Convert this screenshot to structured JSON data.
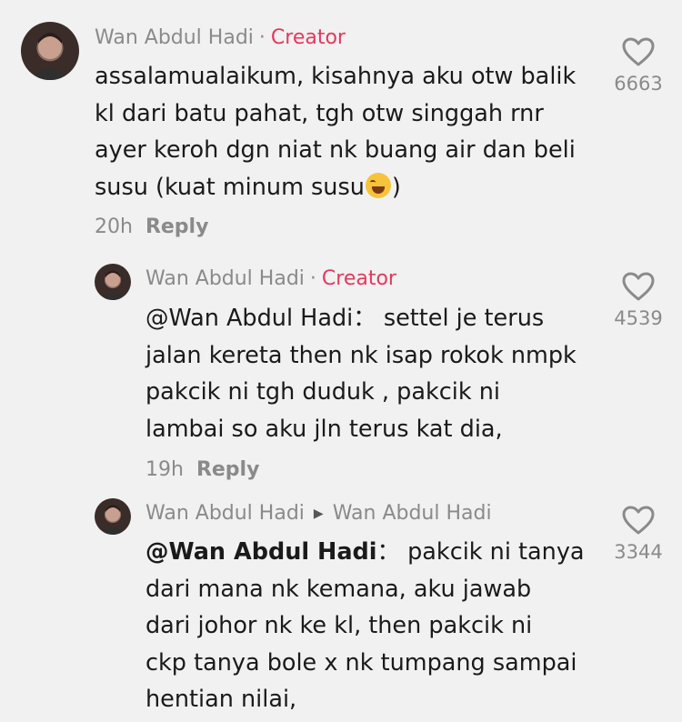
{
  "comments": [
    {
      "author": "Wan Abdul Hadi",
      "badge": "Creator",
      "reply_to": "",
      "mention": "",
      "lines": [
        "assalamualaikum, kisahnya aku otw balik",
        "kl dari batu pahat, tgh otw singgah rnr",
        "ayer keroh dgn niat nk buang air dan beli",
        "susu (kuat minum susu"
      ],
      "line4_emoji": "face-with-tears-of-joy-emoji",
      "line4_tail": ")",
      "time": "20h",
      "reply_label": "Reply",
      "likes": "6663"
    },
    {
      "author": "Wan Abdul Hadi",
      "badge": "Creator",
      "reply_to": "",
      "mention": "@Wan Abdul Hadi",
      "lines": [
        "：  settel je terus",
        "jalan kereta then nk isap rokok nmpk",
        "pakcik ni tgh duduk , pakcik ni",
        "lambai so aku jln terus kat dia,"
      ],
      "time": "19h",
      "reply_label": "Reply",
      "likes": "4539"
    },
    {
      "author": "Wan Abdul Hadi",
      "badge": "",
      "reply_to": "Wan Abdul Hadi",
      "mention": "@Wan Abdul Hadi",
      "lines": [
        "：  pakcik ni tanya",
        "dari mana nk kemana, aku jawab",
        "dari johor nk ke kl, then pakcik ni",
        "ckp tanya bole x nk tumpang sampai",
        "hentian nilai,"
      ],
      "likes": "3344"
    }
  ],
  "colors": {
    "background": "#f1f1f1",
    "creator": "#e5385b",
    "muted": "#8a8a8a",
    "text": "#1a1a1a"
  }
}
